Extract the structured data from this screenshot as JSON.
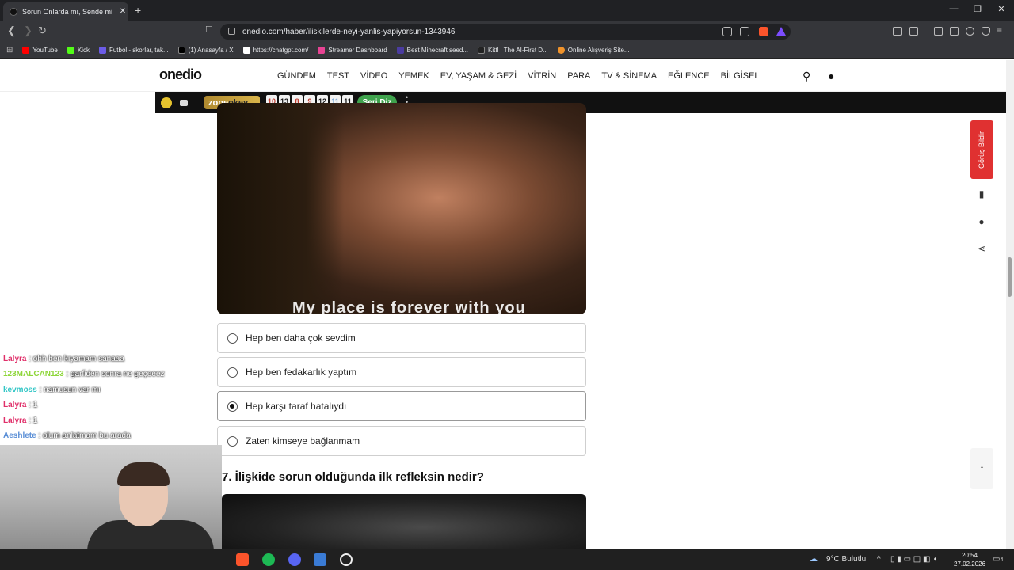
{
  "browser": {
    "tab_title": "Sorun Onlarda mı, Sende mi? - O",
    "url": "onedio.com/haber/iliskilerde-neyi-yanlis-yapiyorsun-1343946",
    "bookmarks": [
      "YouTube",
      "Kick",
      "Futbol - skorlar, tak...",
      "(1) Anasayfa / X",
      "https://chatgpt.com/",
      "Streamer Dashboard",
      "Best Minecraft seed...",
      "Kittl | The AI-First D...",
      "Online Alışveriş Site..."
    ]
  },
  "site": {
    "logo": "onedio",
    "menu": [
      "GÜNDEM",
      "TEST",
      "VİDEO",
      "YEMEK",
      "EV, YAŞAM & GEZİ",
      "VİTRİN",
      "PARA",
      "TV & SİNEMA",
      "EĞLENCE",
      "BİLGİSEL"
    ],
    "game": {
      "brand": "zone",
      "brand2": "okey",
      "tiles": [
        "10",
        "13",
        "8",
        "9",
        "12",
        "11",
        "11"
      ],
      "button": "Seri Diz"
    },
    "image_caption": "My place is forever with you",
    "options": [
      "Hep ben daha çok sevdim",
      "Hep ben fedakarlık yaptım",
      "Hep karşı taraf hatalıydı",
      "Zaten kimseye bağlanmam"
    ],
    "selected_option": 2,
    "next_question": "7. İlişkide sorun olduğunda ilk refleksin nedir?",
    "feedback": "Görüş Bildir"
  },
  "chat": [
    {
      "user": "Lalyra",
      "msg": ": ohh ben kıyamam sanaaa",
      "color": "#e0306a"
    },
    {
      "user": "123MALCAN123",
      "msg": ": garfiden sonra ne geçeeez",
      "color": "#8ed63a"
    },
    {
      "user": "kevmoss",
      "msg": ": namusun var mı",
      "color": "#32c6c6"
    },
    {
      "user": "Lalyra",
      "msg": ": 1",
      "color": "#e0306a"
    },
    {
      "user": "Lalyra",
      "msg": ": 1",
      "color": "#e0306a"
    },
    {
      "user": "Aeshlete",
      "msg": ": olum anlatmam bu arada",
      "color": "#5b8fd6"
    }
  ],
  "taskbar": {
    "weather": "9°C  Bulutlu",
    "time": "20:54",
    "date": "27.02.2026",
    "notif": "4"
  }
}
